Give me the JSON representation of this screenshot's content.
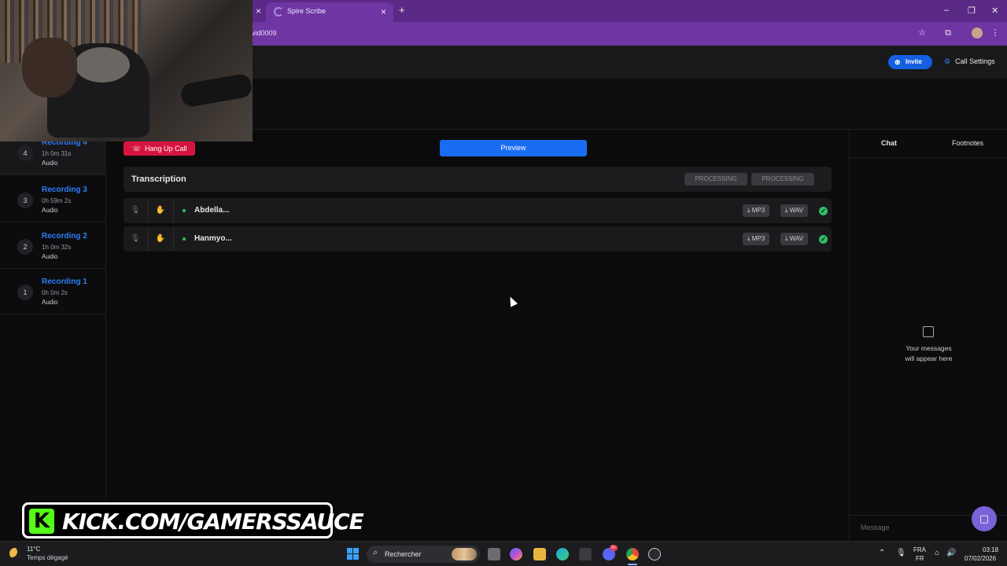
{
  "browser": {
    "tab_title": "Spire Scribe",
    "new_tab_label": "+",
    "close_tab_label": "×",
    "url": "vid0009"
  },
  "header": {
    "invite_label": "Invite",
    "call_settings_label": "Call Settings"
  },
  "sidebar": {
    "recordings": [
      {
        "number": "4",
        "title": "Recording 4",
        "duration": "1h 0m 31s",
        "type": "Audio"
      },
      {
        "number": "3",
        "title": "Recording 3",
        "duration": "0h 59m 2s",
        "type": "Audio"
      },
      {
        "number": "2",
        "title": "Recording 2",
        "duration": "1h 0m 32s",
        "type": "Audio"
      },
      {
        "number": "1",
        "title": "Recording 1",
        "duration": "0h 0m 2s",
        "type": "Audio"
      }
    ]
  },
  "main": {
    "hangup_label": "Hang Up Call",
    "preview_label": "Preview",
    "transcription_title": "Transcription",
    "processing_labels": [
      "PROCESSING",
      "PROCESSING"
    ],
    "tracks": [
      {
        "name": "Abdella...",
        "mp3_label": "MP3",
        "wav_label": "WAV"
      },
      {
        "name": "Hanmyo...",
        "mp3_label": "MP3",
        "wav_label": "WAV"
      }
    ]
  },
  "right_panel": {
    "tabs": [
      "Chat",
      "Footnotes"
    ],
    "empty_line1": "Your messages",
    "empty_line2": "will appear here",
    "message_placeholder": "Message"
  },
  "overlay": {
    "kick_text": "KICK.COM/GAMERSSAUCE",
    "kick_logo_letter": "K"
  },
  "taskbar": {
    "weather_temp": "11°C",
    "weather_desc": "Temps dégagé",
    "search_label": "Rechercher",
    "notification_badge": "9+",
    "lang_top": "FRA",
    "lang_bottom": "FR",
    "time": "03:18",
    "date": "07/02/2026"
  },
  "colors": {
    "accent_blue": "#1a6cf2",
    "hangup_red": "#d6153f",
    "browser_purple": "#6f35a3",
    "status_green": "#2fbf62",
    "kick_green": "#53fc18"
  }
}
